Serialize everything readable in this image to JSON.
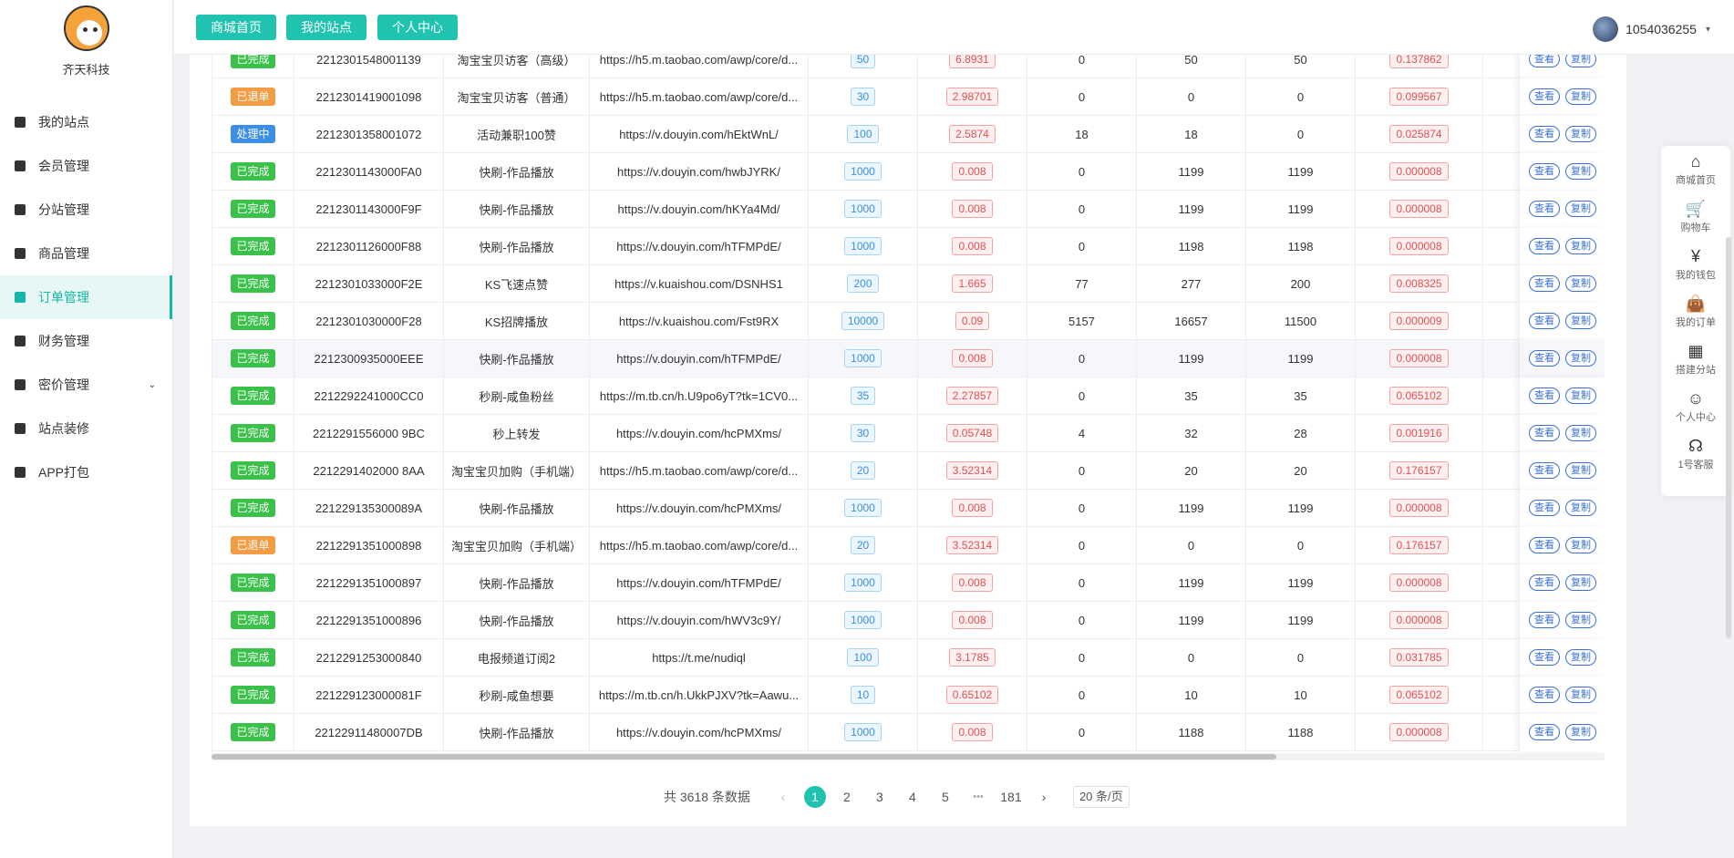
{
  "brand": {
    "name": "齐天科技"
  },
  "sidebar": {
    "items": [
      {
        "label": "我的站点",
        "icon": "dashboard-icon"
      },
      {
        "label": "会员管理",
        "icon": "users-icon"
      },
      {
        "label": "分站管理",
        "icon": "users-icon"
      },
      {
        "label": "商品管理",
        "icon": "box-icon"
      },
      {
        "label": "订单管理",
        "icon": "order-icon",
        "active": true
      },
      {
        "label": "财务管理",
        "icon": "wallet-icon"
      },
      {
        "label": "密价管理",
        "icon": "tag-icon",
        "has_caret": true
      },
      {
        "label": "站点装修",
        "icon": "store-icon"
      },
      {
        "label": "APP打包",
        "icon": "package-icon"
      }
    ]
  },
  "header": {
    "buttons": [
      "商城首页",
      "我的站点",
      "个人中心"
    ],
    "user": "1054036255"
  },
  "table": {
    "rows": [
      {
        "status": "已完成",
        "type": "done",
        "id": "2212301548001139",
        "name": "淘宝宝贝访客（高级）",
        "url": "https://h5.m.taobao.com/awp/core/d...",
        "qty": "50",
        "price": "6.8931",
        "start": "0",
        "current": "50",
        "done_qty": "50",
        "cost": "0.137862"
      },
      {
        "status": "已退单",
        "type": "refund",
        "id": "2212301419001098",
        "name": "淘宝宝贝访客（普通）",
        "url": "https://h5.m.taobao.com/awp/core/d...",
        "qty": "30",
        "price": "2.98701",
        "start": "0",
        "current": "0",
        "done_qty": "0",
        "cost": "0.099567"
      },
      {
        "status": "处理中",
        "type": "proc",
        "id": "2212301358001072",
        "name": "活动兼职100赞",
        "url": "https://v.douyin.com/hEktWnL/",
        "qty": "100",
        "price": "2.5874",
        "start": "18",
        "current": "18",
        "done_qty": "0",
        "cost": "0.025874"
      },
      {
        "status": "已完成",
        "type": "done",
        "id": "2212301143000FA0",
        "name": "快刷-作品播放",
        "url": "https://v.douyin.com/hwbJYRK/",
        "qty": "1000",
        "price": "0.008",
        "start": "0",
        "current": "1199",
        "done_qty": "1199",
        "cost": "0.000008"
      },
      {
        "status": "已完成",
        "type": "done",
        "id": "2212301143000F9F",
        "name": "快刷-作品播放",
        "url": "https://v.douyin.com/hKYa4Md/",
        "qty": "1000",
        "price": "0.008",
        "start": "0",
        "current": "1199",
        "done_qty": "1199",
        "cost": "0.000008"
      },
      {
        "status": "已完成",
        "type": "done",
        "id": "2212301126000F88",
        "name": "快刷-作品播放",
        "url": "https://v.douyin.com/hTFMPdE/",
        "qty": "1000",
        "price": "0.008",
        "start": "0",
        "current": "1198",
        "done_qty": "1198",
        "cost": "0.000008"
      },
      {
        "status": "已完成",
        "type": "done",
        "id": "2212301033000F2E",
        "name": "KS飞速点赞",
        "url": "https://v.kuaishou.com/DSNHS1",
        "qty": "200",
        "price": "1.665",
        "start": "77",
        "current": "277",
        "done_qty": "200",
        "cost": "0.008325"
      },
      {
        "status": "已完成",
        "type": "done",
        "id": "2212301030000F28",
        "name": "KS招牌播放",
        "url": "https://v.kuaishou.com/Fst9RX",
        "qty": "10000",
        "price": "0.09",
        "start": "5157",
        "current": "16657",
        "done_qty": "11500",
        "cost": "0.000009"
      },
      {
        "status": "已完成",
        "type": "done",
        "id": "2212300935000EEE",
        "name": "快刷-作品播放",
        "url": "https://v.douyin.com/hTFMPdE/",
        "qty": "1000",
        "price": "0.008",
        "start": "0",
        "current": "1199",
        "done_qty": "1199",
        "cost": "0.000008",
        "hover": true
      },
      {
        "status": "已完成",
        "type": "done",
        "id": "2212292241000CC0",
        "name": "秒刷-咸鱼粉丝",
        "url": "https://m.tb.cn/h.U9po6yT?tk=1CV0...",
        "qty": "35",
        "price": "2.27857",
        "start": "0",
        "current": "35",
        "done_qty": "35",
        "cost": "0.065102"
      },
      {
        "status": "已完成",
        "type": "done",
        "id": "2212291556000 9BC",
        "name": "秒上转发",
        "url": "https://v.douyin.com/hcPMXms/",
        "qty": "30",
        "price": "0.05748",
        "start": "4",
        "current": "32",
        "done_qty": "28",
        "cost": "0.001916"
      },
      {
        "status": "已完成",
        "type": "done",
        "id": "2212291402000 8AA",
        "name": "淘宝宝贝加购（手机端）",
        "url": "https://h5.m.taobao.com/awp/core/d...",
        "qty": "20",
        "price": "3.52314",
        "start": "0",
        "current": "20",
        "done_qty": "20",
        "cost": "0.176157"
      },
      {
        "status": "已完成",
        "type": "done",
        "id": "221229135300089A",
        "name": "快刷-作品播放",
        "url": "https://v.douyin.com/hcPMXms/",
        "qty": "1000",
        "price": "0.008",
        "start": "0",
        "current": "1199",
        "done_qty": "1199",
        "cost": "0.000008"
      },
      {
        "status": "已退单",
        "type": "refund",
        "id": "2212291351000898",
        "name": "淘宝宝贝加购（手机端）",
        "url": "https://h5.m.taobao.com/awp/core/d...",
        "qty": "20",
        "price": "3.52314",
        "start": "0",
        "current": "0",
        "done_qty": "0",
        "cost": "0.176157"
      },
      {
        "status": "已完成",
        "type": "done",
        "id": "2212291351000897",
        "name": "快刷-作品播放",
        "url": "https://v.douyin.com/hTFMPdE/",
        "qty": "1000",
        "price": "0.008",
        "start": "0",
        "current": "1199",
        "done_qty": "1199",
        "cost": "0.000008"
      },
      {
        "status": "已完成",
        "type": "done",
        "id": "2212291351000896",
        "name": "快刷-作品播放",
        "url": "https://v.douyin.com/hWV3c9Y/",
        "qty": "1000",
        "price": "0.008",
        "start": "0",
        "current": "1199",
        "done_qty": "1199",
        "cost": "0.000008"
      },
      {
        "status": "已完成",
        "type": "done",
        "id": "2212291253000840",
        "name": "电报频道订阅2",
        "url": "https://t.me/nudiql",
        "qty": "100",
        "price": "3.1785",
        "start": "0",
        "current": "0",
        "done_qty": "0",
        "cost": "0.031785"
      },
      {
        "status": "已完成",
        "type": "done",
        "id": "221229123000081F",
        "name": "秒刷-咸鱼想要",
        "url": "https://m.tb.cn/h.UkkPJXV?tk=Aawu...",
        "qty": "10",
        "price": "0.65102",
        "start": "0",
        "current": "10",
        "done_qty": "10",
        "cost": "0.065102"
      },
      {
        "status": "已完成",
        "type": "done",
        "id": "22122911480007DB",
        "name": "快刷-作品播放",
        "url": "https://v.douyin.com/hcPMXms/",
        "qty": "1000",
        "price": "0.008",
        "start": "0",
        "current": "1188",
        "done_qty": "1188",
        "cost": "0.000008"
      }
    ],
    "op_view": "查看",
    "op_copy": "复制"
  },
  "pager": {
    "total": "共 3618 条数据",
    "prev": "‹",
    "next": "›",
    "pages": [
      "1",
      "2",
      "3",
      "4",
      "5"
    ],
    "ellipsis": "•••",
    "last": "181",
    "size": "20 条/页"
  },
  "float_menu": [
    {
      "label": "商城首页",
      "icon": "home-icon",
      "glyph": "⌂"
    },
    {
      "label": "购物车",
      "icon": "cart-icon",
      "glyph": "🛒"
    },
    {
      "label": "我的钱包",
      "icon": "wallet-icon",
      "glyph": "¥"
    },
    {
      "label": "我的订单",
      "icon": "bag-icon",
      "glyph": "👜"
    },
    {
      "label": "搭建分站",
      "icon": "grid-icon",
      "glyph": "▦"
    },
    {
      "label": "个人中心",
      "icon": "user-icon",
      "glyph": "☺"
    },
    {
      "label": "1号客服",
      "icon": "headset-icon",
      "glyph": "☊"
    }
  ]
}
